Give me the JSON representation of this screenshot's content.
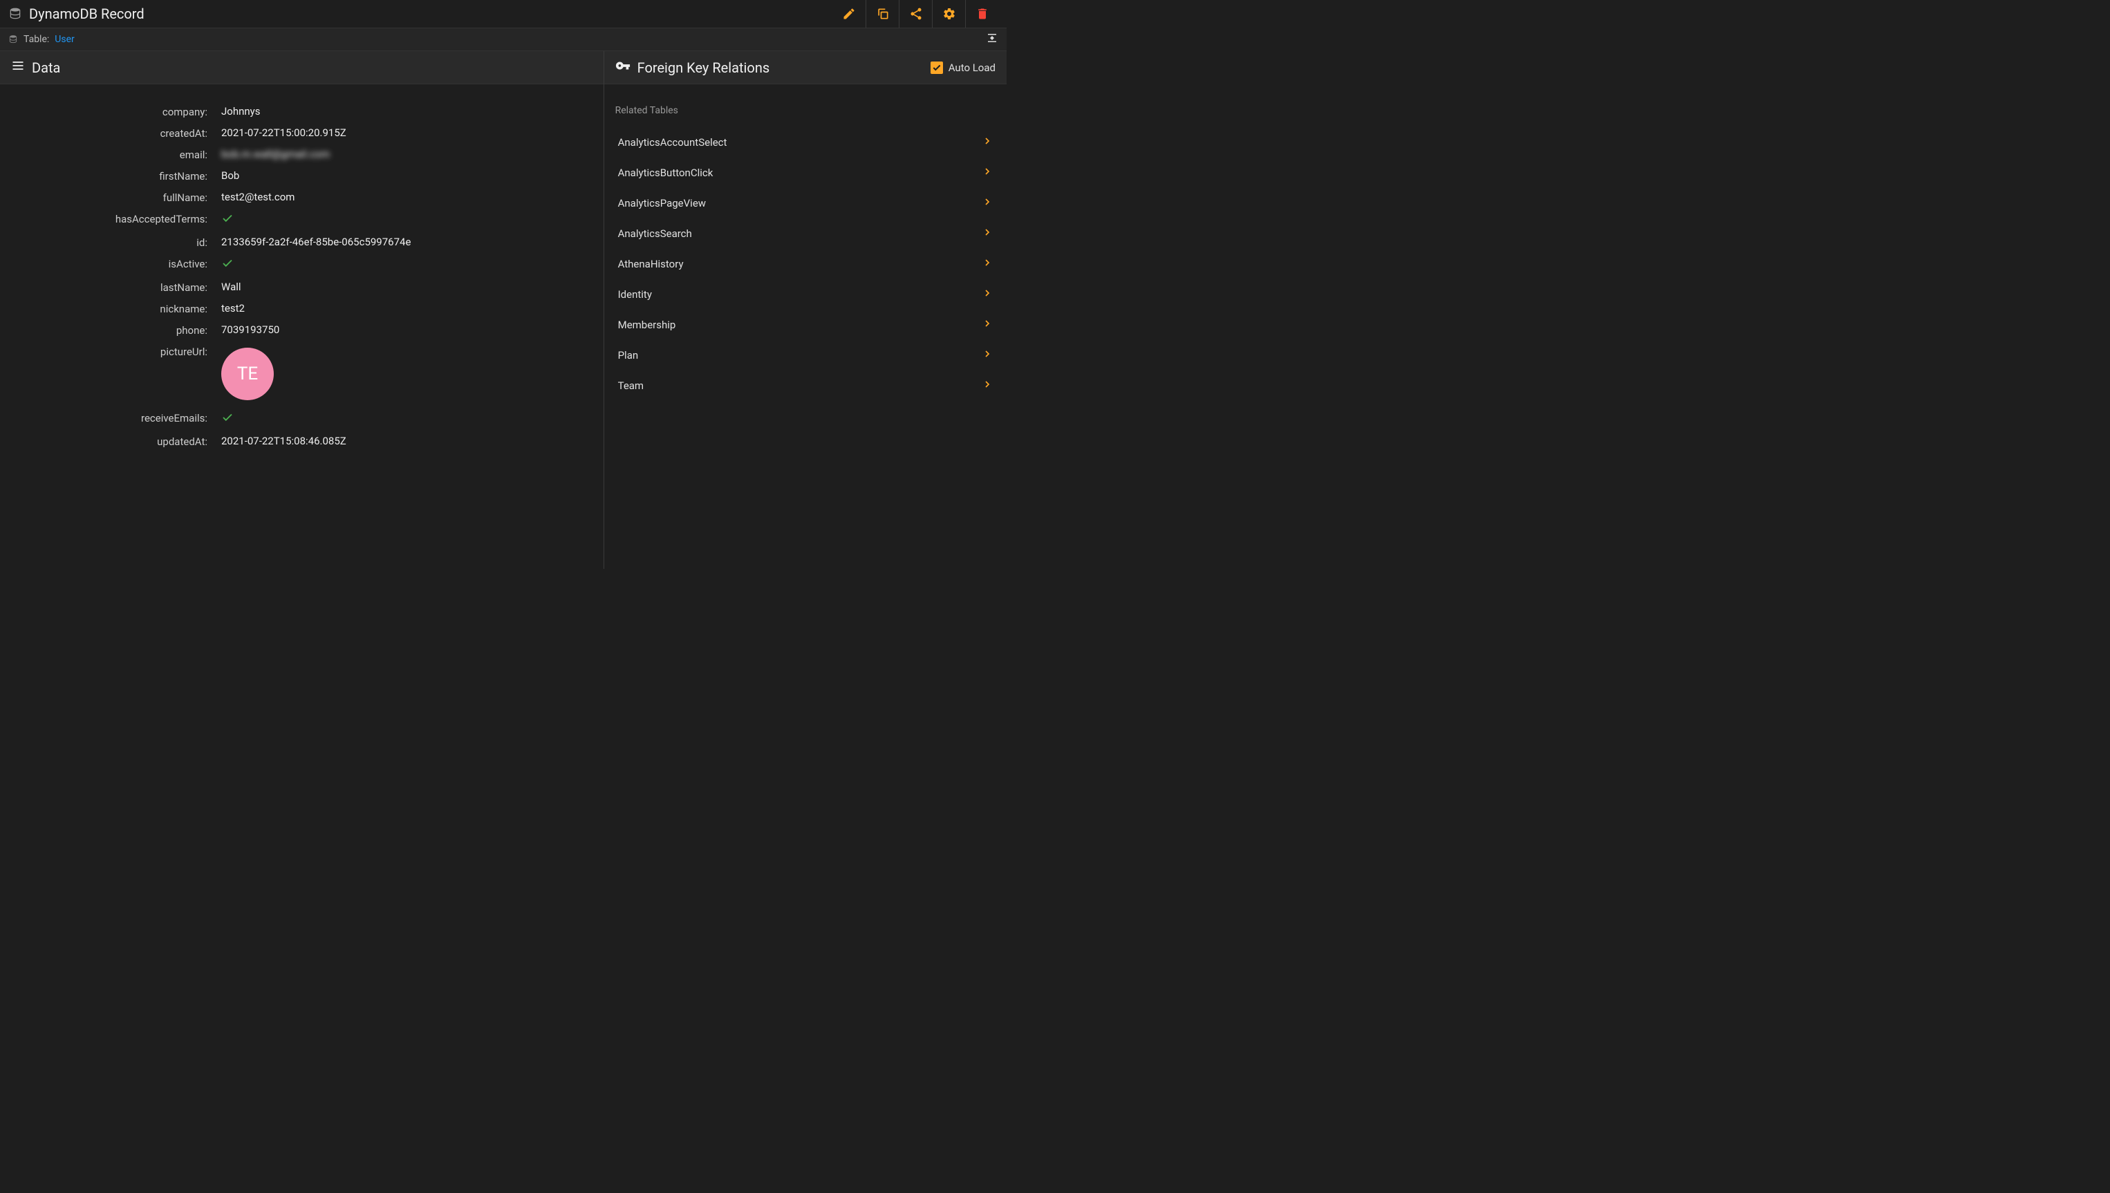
{
  "header": {
    "title": "DynamoDB Record"
  },
  "subheader": {
    "table_label": "Table:",
    "table_name": "User"
  },
  "data_section": {
    "title": "Data"
  },
  "fk_section": {
    "title": "Foreign Key Relations",
    "autoload_label": "Auto Load",
    "related_label": "Related Tables",
    "tables": [
      "AnalyticsAccountSelect",
      "AnalyticsButtonClick",
      "AnalyticsPageView",
      "AnalyticsSearch",
      "AthenaHistory",
      "Identity",
      "Membership",
      "Plan",
      "Team"
    ]
  },
  "record": {
    "company": {
      "k": "company:",
      "v": "Johnnys"
    },
    "createdAt": {
      "k": "createdAt:",
      "v": "2021-07-22T15:00:20.915Z"
    },
    "email": {
      "k": "email:",
      "v": "bob.m.wall@gmail.com"
    },
    "firstName": {
      "k": "firstName:",
      "v": "Bob"
    },
    "fullName": {
      "k": "fullName:",
      "v": "test2@test.com"
    },
    "hasAcceptedTerms": {
      "k": "hasAcceptedTerms:",
      "v": true
    },
    "id": {
      "k": "id:",
      "v": "2133659f-2a2f-46ef-85be-065c5997674e"
    },
    "isActive": {
      "k": "isActive:",
      "v": true
    },
    "lastName": {
      "k": "lastName:",
      "v": "Wall"
    },
    "nickname": {
      "k": "nickname:",
      "v": "test2"
    },
    "phone": {
      "k": "phone:",
      "v": "7039193750"
    },
    "pictureUrl": {
      "k": "pictureUrl:",
      "initials": "TE"
    },
    "receiveEmails": {
      "k": "receiveEmails:",
      "v": true
    },
    "updatedAt": {
      "k": "updatedAt:",
      "v": "2021-07-22T15:08:46.085Z"
    }
  },
  "colors": {
    "accent": "#ffa726",
    "link": "#2196f3",
    "danger": "#f44336",
    "success": "#4caf50",
    "avatar": "#f48fb1"
  }
}
